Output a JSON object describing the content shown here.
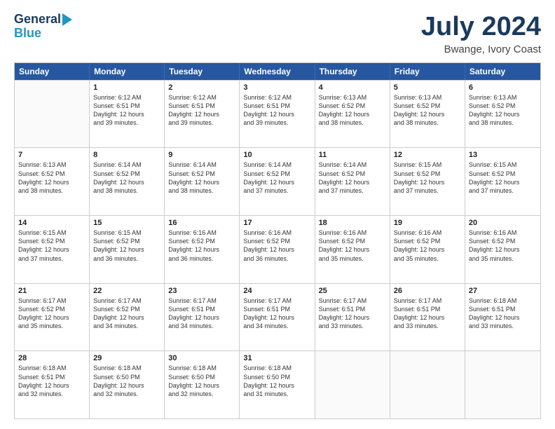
{
  "logo": {
    "line1": "General",
    "line2": "Blue"
  },
  "title": "July 2024",
  "location": "Bwange, Ivory Coast",
  "days_of_week": [
    "Sunday",
    "Monday",
    "Tuesday",
    "Wednesday",
    "Thursday",
    "Friday",
    "Saturday"
  ],
  "weeks": [
    [
      {
        "day": "",
        "lines": []
      },
      {
        "day": "1",
        "lines": [
          "Sunrise: 6:12 AM",
          "Sunset: 6:51 PM",
          "Daylight: 12 hours",
          "and 39 minutes."
        ]
      },
      {
        "day": "2",
        "lines": [
          "Sunrise: 6:12 AM",
          "Sunset: 6:51 PM",
          "Daylight: 12 hours",
          "and 39 minutes."
        ]
      },
      {
        "day": "3",
        "lines": [
          "Sunrise: 6:12 AM",
          "Sunset: 6:51 PM",
          "Daylight: 12 hours",
          "and 39 minutes."
        ]
      },
      {
        "day": "4",
        "lines": [
          "Sunrise: 6:13 AM",
          "Sunset: 6:52 PM",
          "Daylight: 12 hours",
          "and 38 minutes."
        ]
      },
      {
        "day": "5",
        "lines": [
          "Sunrise: 6:13 AM",
          "Sunset: 6:52 PM",
          "Daylight: 12 hours",
          "and 38 minutes."
        ]
      },
      {
        "day": "6",
        "lines": [
          "Sunrise: 6:13 AM",
          "Sunset: 6:52 PM",
          "Daylight: 12 hours",
          "and 38 minutes."
        ]
      }
    ],
    [
      {
        "day": "7",
        "lines": [
          "Sunrise: 6:13 AM",
          "Sunset: 6:52 PM",
          "Daylight: 12 hours",
          "and 38 minutes."
        ]
      },
      {
        "day": "8",
        "lines": [
          "Sunrise: 6:14 AM",
          "Sunset: 6:52 PM",
          "Daylight: 12 hours",
          "and 38 minutes."
        ]
      },
      {
        "day": "9",
        "lines": [
          "Sunrise: 6:14 AM",
          "Sunset: 6:52 PM",
          "Daylight: 12 hours",
          "and 38 minutes."
        ]
      },
      {
        "day": "10",
        "lines": [
          "Sunrise: 6:14 AM",
          "Sunset: 6:52 PM",
          "Daylight: 12 hours",
          "and 37 minutes."
        ]
      },
      {
        "day": "11",
        "lines": [
          "Sunrise: 6:14 AM",
          "Sunset: 6:52 PM",
          "Daylight: 12 hours",
          "and 37 minutes."
        ]
      },
      {
        "day": "12",
        "lines": [
          "Sunrise: 6:15 AM",
          "Sunset: 6:52 PM",
          "Daylight: 12 hours",
          "and 37 minutes."
        ]
      },
      {
        "day": "13",
        "lines": [
          "Sunrise: 6:15 AM",
          "Sunset: 6:52 PM",
          "Daylight: 12 hours",
          "and 37 minutes."
        ]
      }
    ],
    [
      {
        "day": "14",
        "lines": [
          "Sunrise: 6:15 AM",
          "Sunset: 6:52 PM",
          "Daylight: 12 hours",
          "and 37 minutes."
        ]
      },
      {
        "day": "15",
        "lines": [
          "Sunrise: 6:15 AM",
          "Sunset: 6:52 PM",
          "Daylight: 12 hours",
          "and 36 minutes."
        ]
      },
      {
        "day": "16",
        "lines": [
          "Sunrise: 6:16 AM",
          "Sunset: 6:52 PM",
          "Daylight: 12 hours",
          "and 36 minutes."
        ]
      },
      {
        "day": "17",
        "lines": [
          "Sunrise: 6:16 AM",
          "Sunset: 6:52 PM",
          "Daylight: 12 hours",
          "and 36 minutes."
        ]
      },
      {
        "day": "18",
        "lines": [
          "Sunrise: 6:16 AM",
          "Sunset: 6:52 PM",
          "Daylight: 12 hours",
          "and 35 minutes."
        ]
      },
      {
        "day": "19",
        "lines": [
          "Sunrise: 6:16 AM",
          "Sunset: 6:52 PM",
          "Daylight: 12 hours",
          "and 35 minutes."
        ]
      },
      {
        "day": "20",
        "lines": [
          "Sunrise: 6:16 AM",
          "Sunset: 6:52 PM",
          "Daylight: 12 hours",
          "and 35 minutes."
        ]
      }
    ],
    [
      {
        "day": "21",
        "lines": [
          "Sunrise: 6:17 AM",
          "Sunset: 6:52 PM",
          "Daylight: 12 hours",
          "and 35 minutes."
        ]
      },
      {
        "day": "22",
        "lines": [
          "Sunrise: 6:17 AM",
          "Sunset: 6:52 PM",
          "Daylight: 12 hours",
          "and 34 minutes."
        ]
      },
      {
        "day": "23",
        "lines": [
          "Sunrise: 6:17 AM",
          "Sunset: 6:51 PM",
          "Daylight: 12 hours",
          "and 34 minutes."
        ]
      },
      {
        "day": "24",
        "lines": [
          "Sunrise: 6:17 AM",
          "Sunset: 6:51 PM",
          "Daylight: 12 hours",
          "and 34 minutes."
        ]
      },
      {
        "day": "25",
        "lines": [
          "Sunrise: 6:17 AM",
          "Sunset: 6:51 PM",
          "Daylight: 12 hours",
          "and 33 minutes."
        ]
      },
      {
        "day": "26",
        "lines": [
          "Sunrise: 6:17 AM",
          "Sunset: 6:51 PM",
          "Daylight: 12 hours",
          "and 33 minutes."
        ]
      },
      {
        "day": "27",
        "lines": [
          "Sunrise: 6:18 AM",
          "Sunset: 6:51 PM",
          "Daylight: 12 hours",
          "and 33 minutes."
        ]
      }
    ],
    [
      {
        "day": "28",
        "lines": [
          "Sunrise: 6:18 AM",
          "Sunset: 6:51 PM",
          "Daylight: 12 hours",
          "and 32 minutes."
        ]
      },
      {
        "day": "29",
        "lines": [
          "Sunrise: 6:18 AM",
          "Sunset: 6:50 PM",
          "Daylight: 12 hours",
          "and 32 minutes."
        ]
      },
      {
        "day": "30",
        "lines": [
          "Sunrise: 6:18 AM",
          "Sunset: 6:50 PM",
          "Daylight: 12 hours",
          "and 32 minutes."
        ]
      },
      {
        "day": "31",
        "lines": [
          "Sunrise: 6:18 AM",
          "Sunset: 6:50 PM",
          "Daylight: 12 hours",
          "and 31 minutes."
        ]
      },
      {
        "day": "",
        "lines": []
      },
      {
        "day": "",
        "lines": []
      },
      {
        "day": "",
        "lines": []
      }
    ]
  ]
}
